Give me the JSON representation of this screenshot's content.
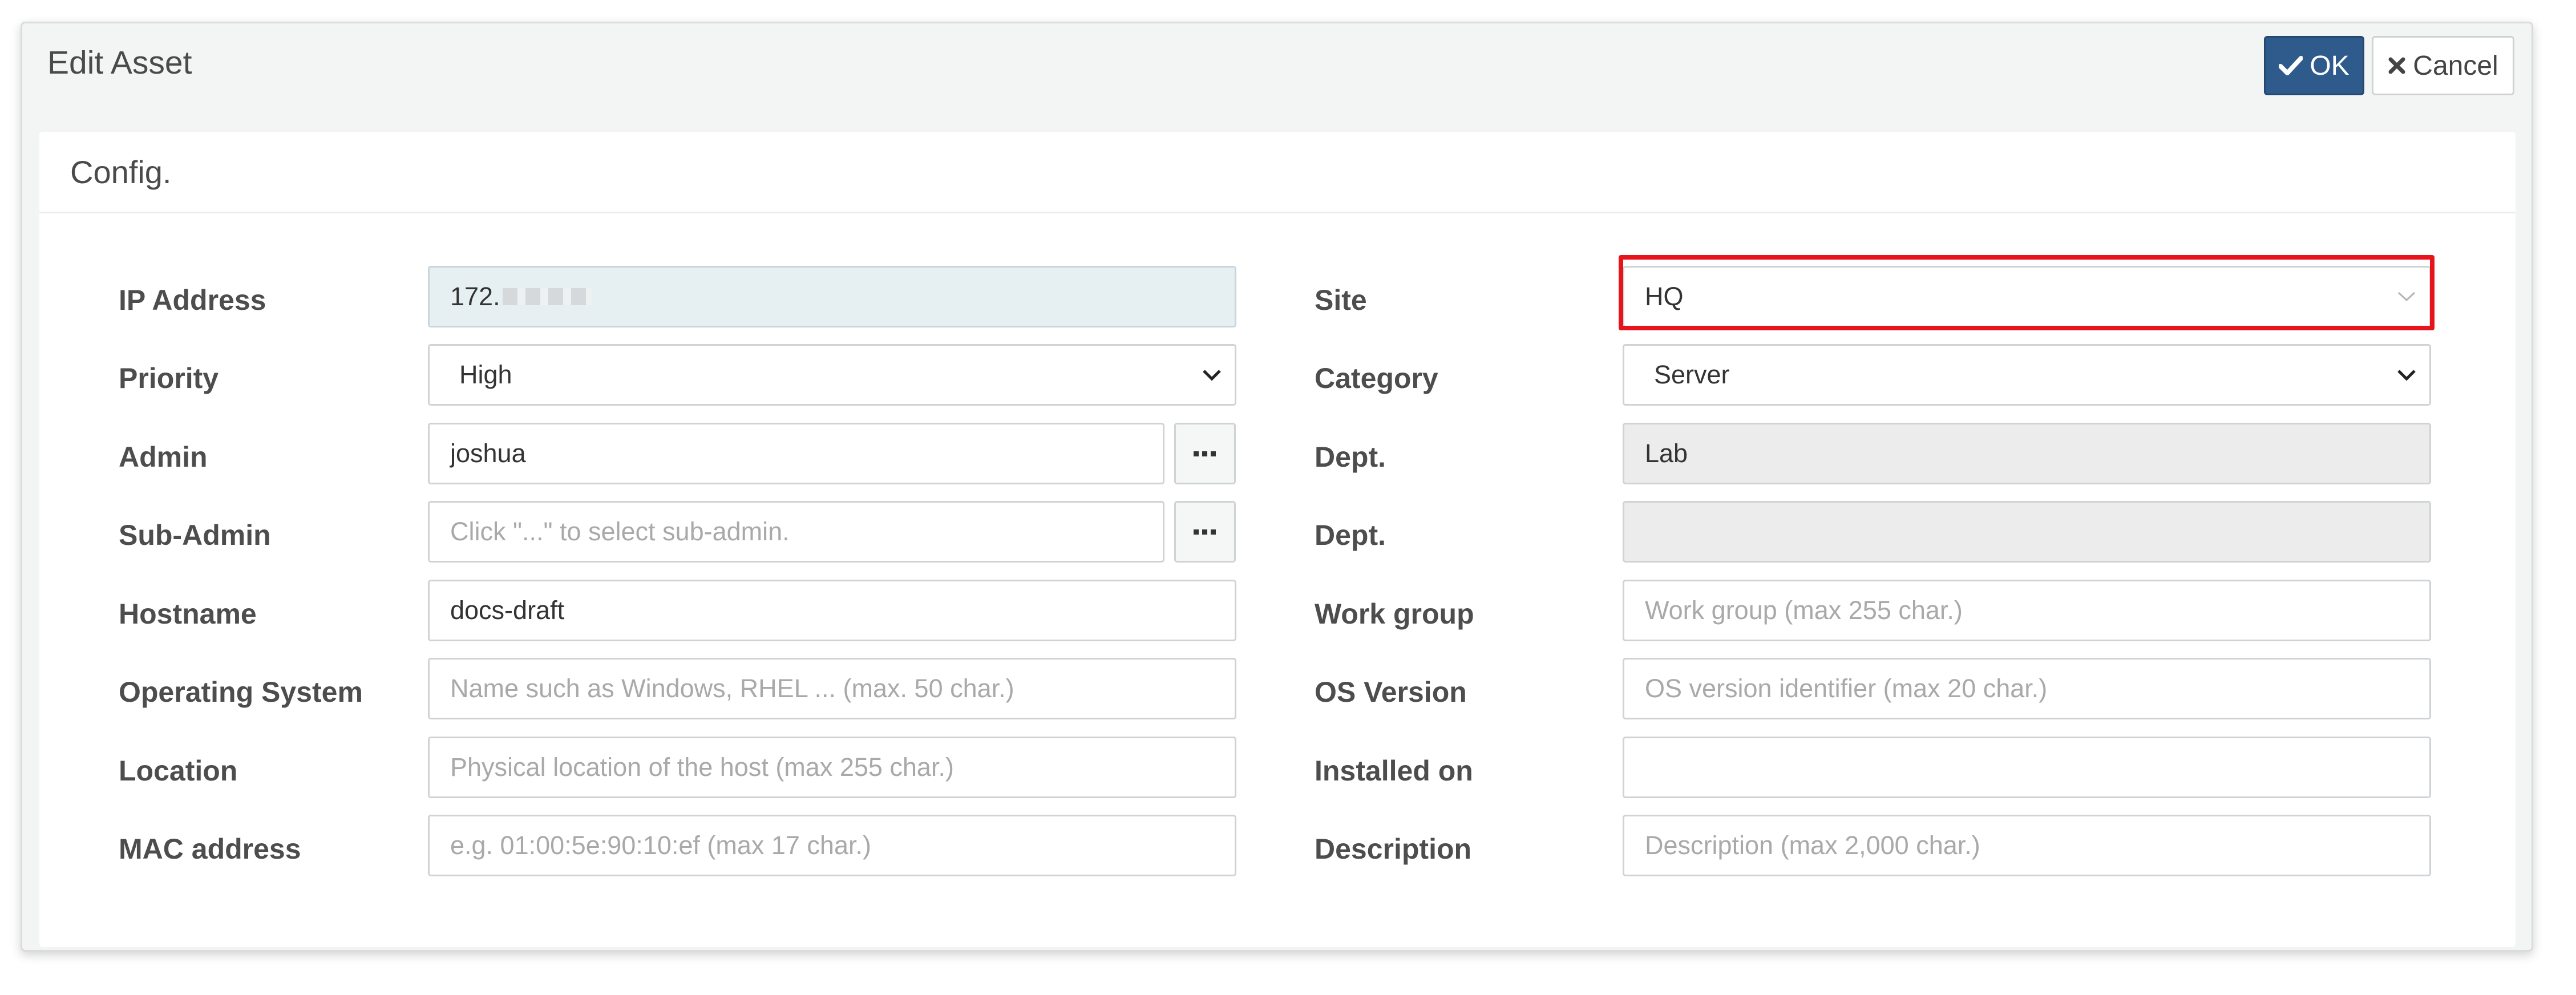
{
  "dialog": {
    "title": "Edit Asset",
    "ok_label": "OK",
    "cancel_label": "Cancel"
  },
  "panel": {
    "title": "Config."
  },
  "left": {
    "ip": {
      "label": "IP Address",
      "value": "172."
    },
    "priority": {
      "label": "Priority",
      "value": "High"
    },
    "admin": {
      "label": "Admin",
      "value": "joshua"
    },
    "subadmin": {
      "label": "Sub-Admin",
      "placeholder": "Click \"...\" to select sub-admin."
    },
    "hostname": {
      "label": "Hostname",
      "value": "docs-draft"
    },
    "os": {
      "label": "Operating System",
      "placeholder": "Name such as Windows, RHEL ... (max. 50 char.)"
    },
    "location": {
      "label": "Location",
      "placeholder": "Physical location of the host (max 255 char.)"
    },
    "mac": {
      "label": "MAC address",
      "placeholder": "e.g. 01:00:5e:90:10:ef (max 17 char.)"
    }
  },
  "right": {
    "site": {
      "label": "Site",
      "value": "HQ"
    },
    "category": {
      "label": "Category",
      "value": "Server"
    },
    "dept1": {
      "label": "Dept.",
      "value": "Lab"
    },
    "dept2": {
      "label": "Dept.",
      "value": ""
    },
    "workgroup": {
      "label": "Work group",
      "placeholder": "Work group (max 255 char.)"
    },
    "osversion": {
      "label": "OS Version",
      "placeholder": "OS version identifier (max 20 char.)"
    },
    "installed": {
      "label": "Installed on",
      "value": ""
    },
    "description": {
      "label": "Description",
      "placeholder": "Description (max 2,000 char.)"
    }
  },
  "colors": {
    "primary": "#2e5b8c",
    "highlight": "#e8141b",
    "readonly": "#ececec"
  }
}
